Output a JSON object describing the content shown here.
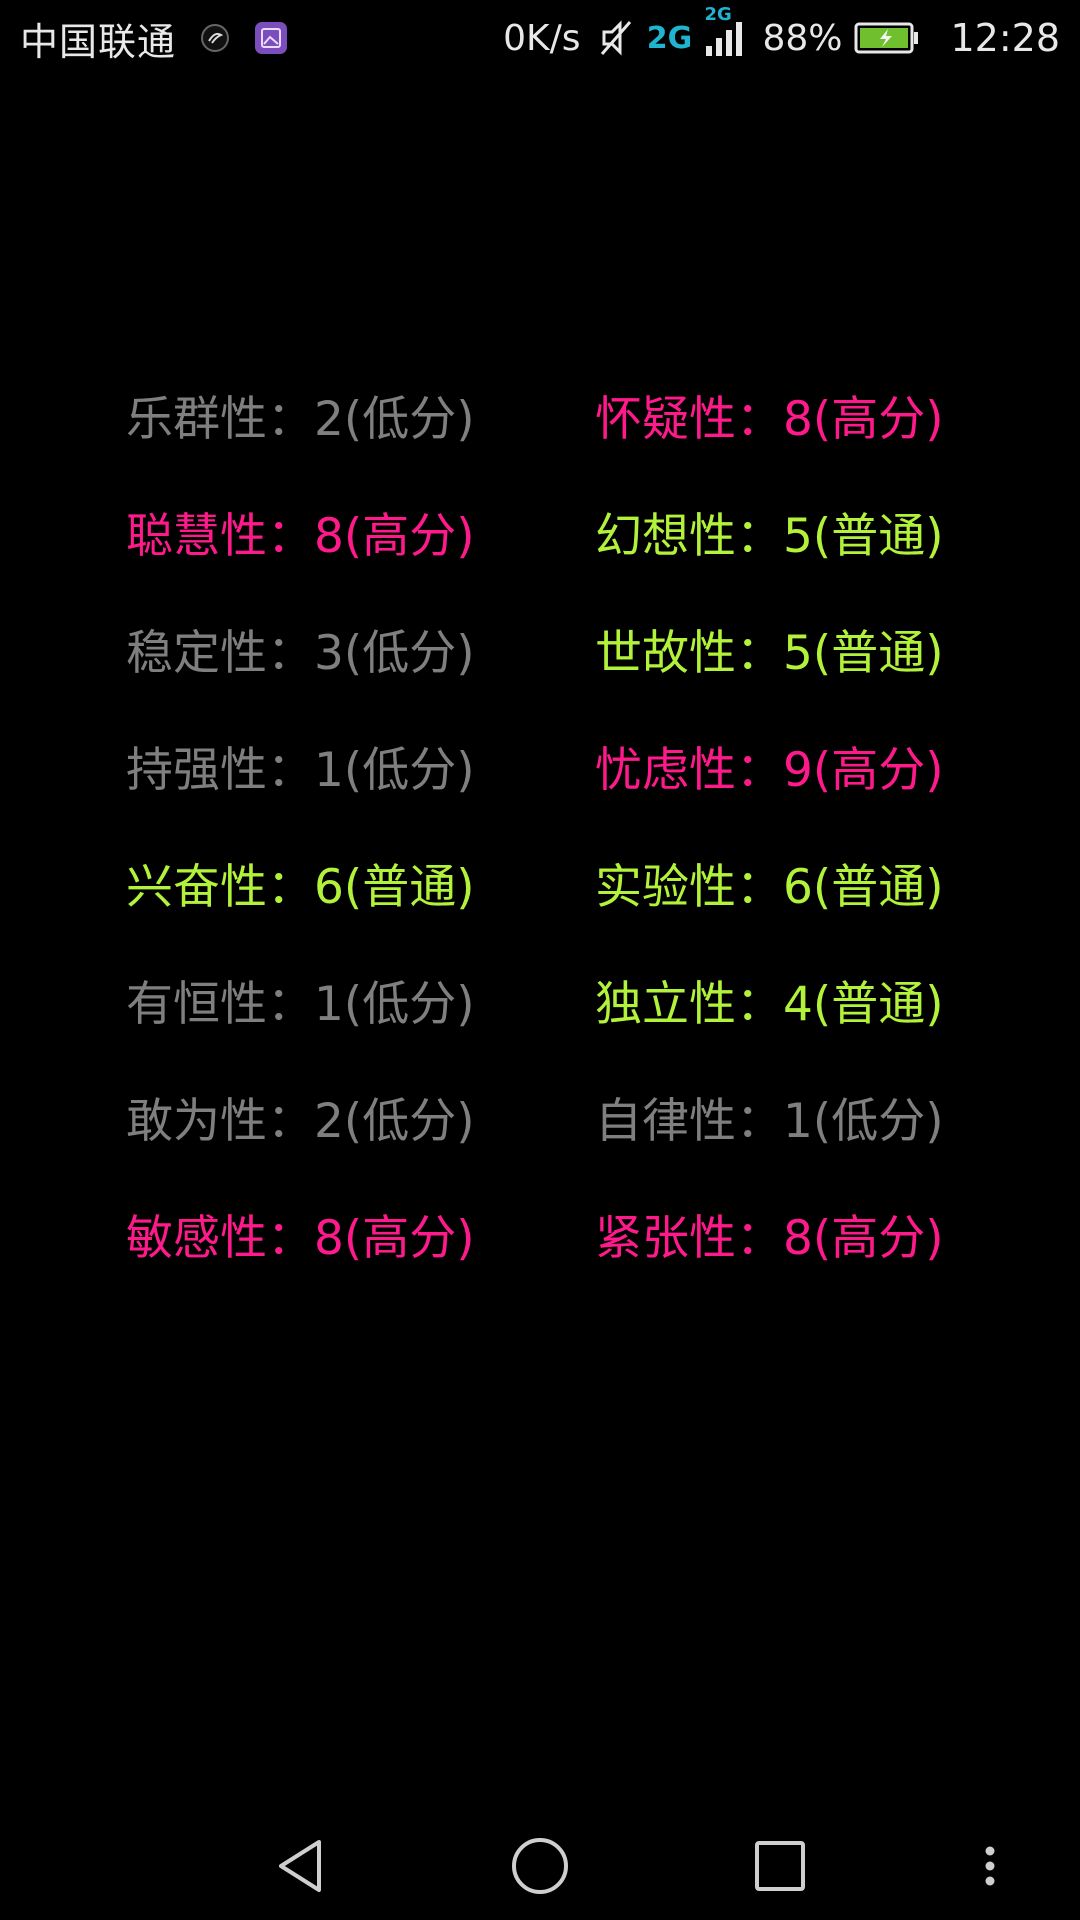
{
  "status_bar": {
    "carrier": "中国联通",
    "net_speed": "0K/s",
    "network_type_main": "2G",
    "network_type_secondary": "2G",
    "battery_percent": "88%",
    "time": "12:28",
    "battery_color": "#6fbf2f",
    "network_color": "#1fb5d0"
  },
  "colors": {
    "low": "#7f7f7f",
    "high": "#ff1a8c",
    "normal": "#b3f23a",
    "background": "#000000"
  },
  "traits": [
    {
      "label": "乐群性：2(低分)",
      "level": "low"
    },
    {
      "label": "怀疑性：8(高分)",
      "level": "high"
    },
    {
      "label": "聪慧性：8(高分)",
      "level": "high"
    },
    {
      "label": "幻想性：5(普通)",
      "level": "normal"
    },
    {
      "label": "稳定性：3(低分)",
      "level": "low"
    },
    {
      "label": "世故性：5(普通)",
      "level": "normal"
    },
    {
      "label": "持强性：1(低分)",
      "level": "low"
    },
    {
      "label": "忧虑性：9(高分)",
      "level": "high"
    },
    {
      "label": "兴奋性：6(普通)",
      "level": "normal"
    },
    {
      "label": "实验性：6(普通)",
      "level": "normal"
    },
    {
      "label": "有恒性：1(低分)",
      "level": "low"
    },
    {
      "label": "独立性：4(普通)",
      "level": "normal"
    },
    {
      "label": "敢为性：2(低分)",
      "level": "low"
    },
    {
      "label": "自律性：1(低分)",
      "level": "low"
    },
    {
      "label": "敏感性：8(高分)",
      "level": "high"
    },
    {
      "label": "紧张性：8(高分)",
      "level": "high"
    }
  ],
  "nav_bar": {
    "back_icon": "back-triangle-icon",
    "home_icon": "home-circle-icon",
    "recents_icon": "recents-square-icon",
    "menu_icon": "overflow-dots-icon"
  }
}
